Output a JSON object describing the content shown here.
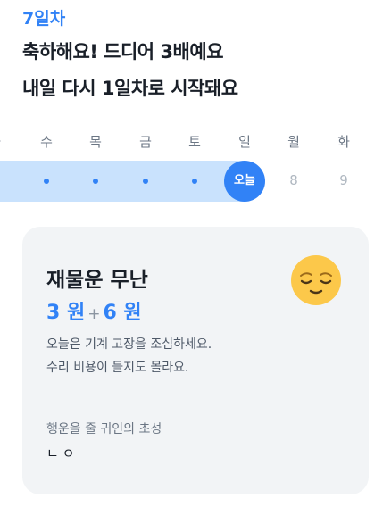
{
  "header": {
    "day_label": "7일차",
    "headline_line1": "축하해요! 드디어 3배예요",
    "headline_line2": "내일 다시 1일차로 시작돼요"
  },
  "week": {
    "weekdays": [
      "화",
      "수",
      "목",
      "금",
      "토",
      "일",
      "월",
      "화"
    ],
    "today_label": "오늘",
    "future_days": [
      "8",
      "9"
    ],
    "accent_color": "#3182f6",
    "track_color": "#c9e2fd"
  },
  "fortune": {
    "title": "재물운 무난",
    "amount_a": "3 원",
    "plus": "+",
    "amount_b": "6 원",
    "description_line1": "오늘은 기계 고장을 조심하세요.",
    "description_line2": "수리 비용이 들지도 몰라요.",
    "hint_label": "행운을 줄 귀인의 초성",
    "hint_value": "ㄴㅇ",
    "mood_icon": "relieved-face-icon"
  }
}
